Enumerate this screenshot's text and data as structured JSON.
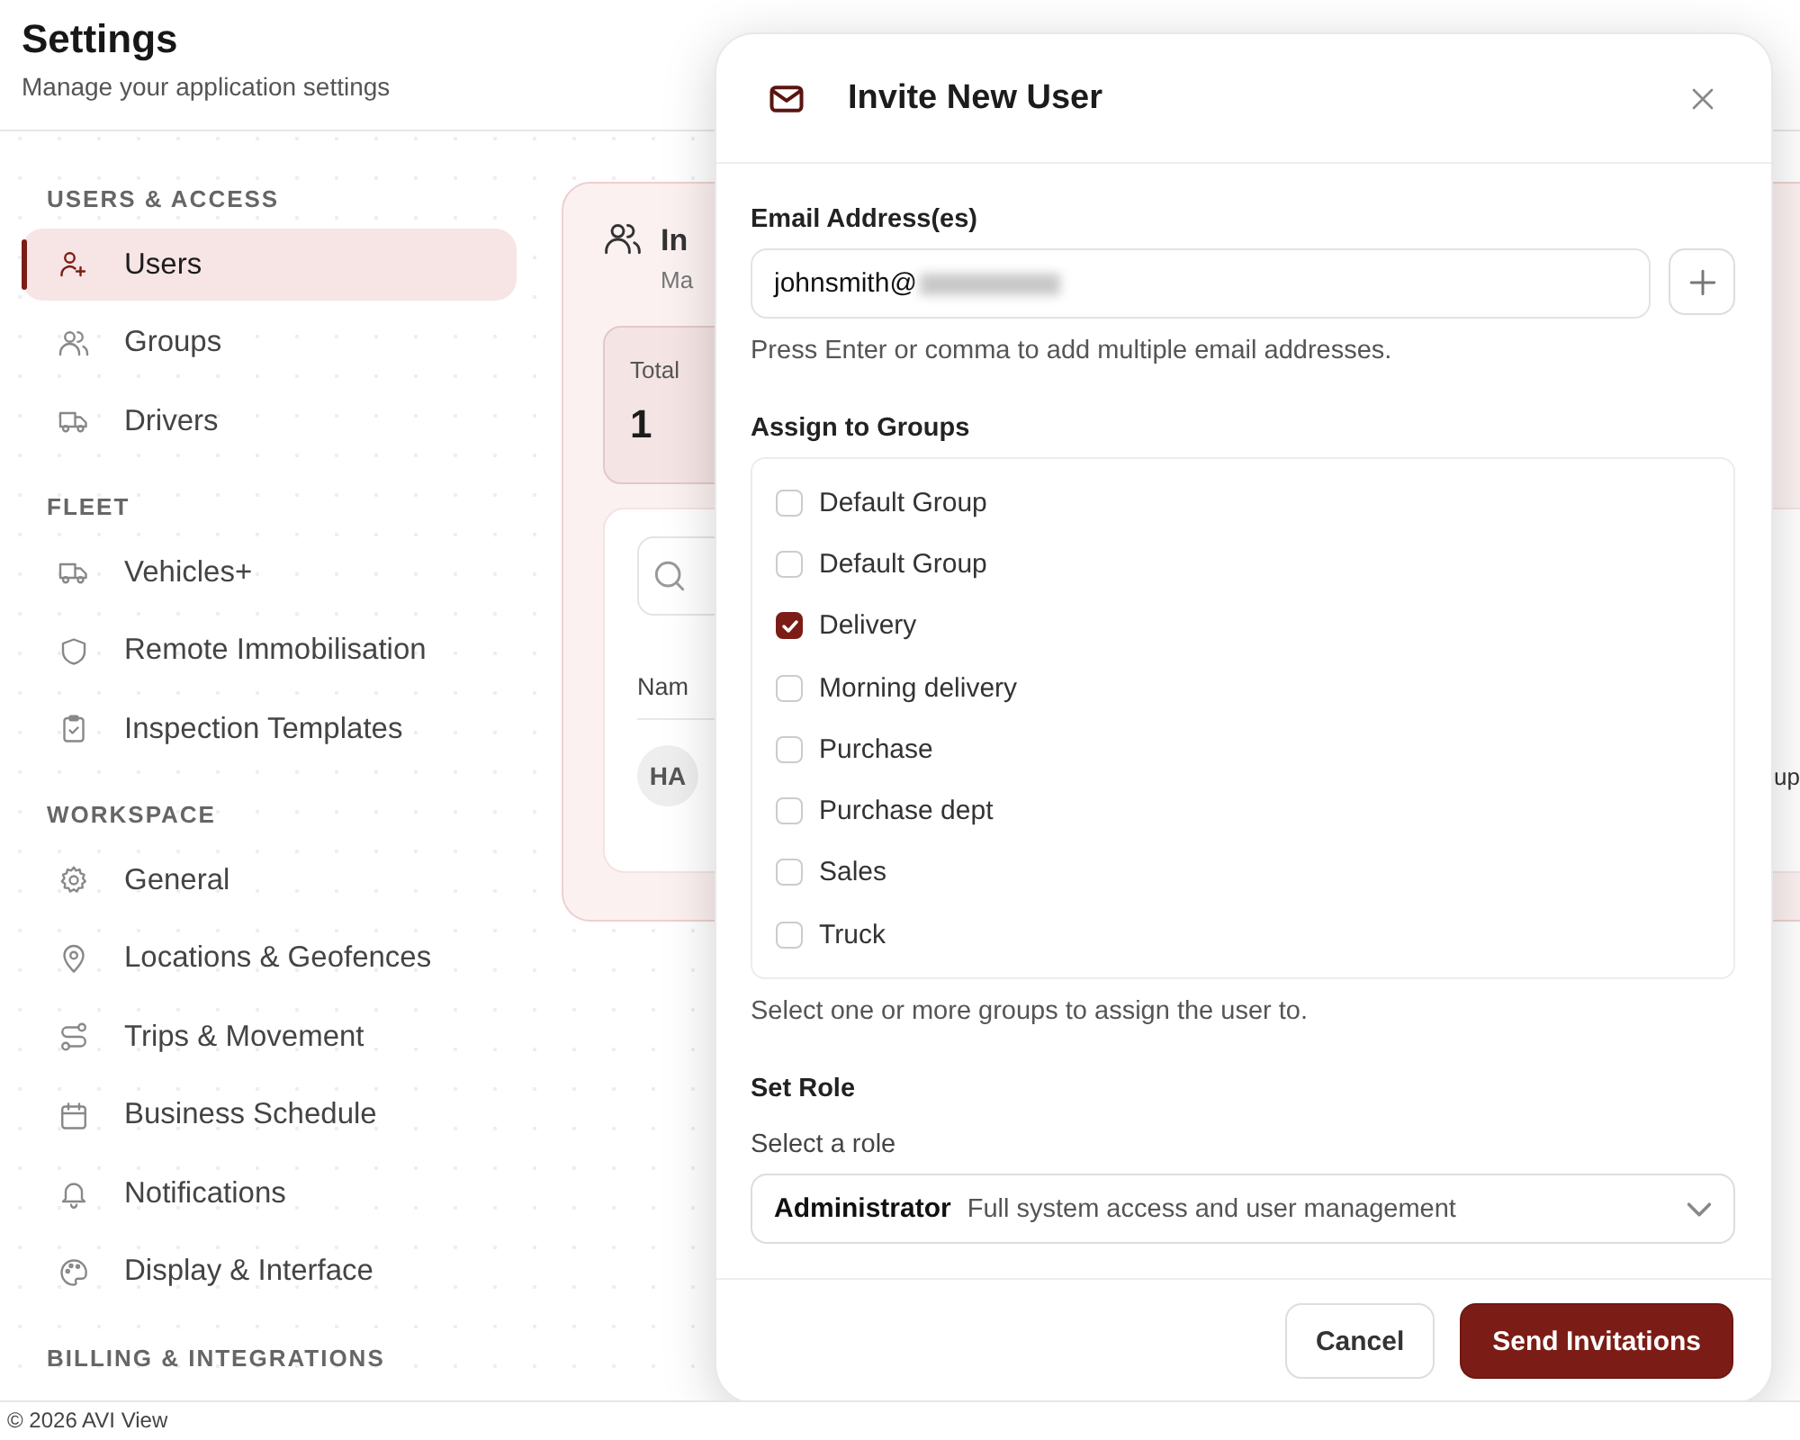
{
  "header": {
    "title": "Settings",
    "subtitle": "Manage your application settings"
  },
  "sidebar": {
    "sections": [
      {
        "heading": "USERS & ACCESS",
        "items": [
          {
            "label": "Users",
            "selected": true
          },
          {
            "label": "Groups",
            "selected": false
          },
          {
            "label": "Drivers",
            "selected": false
          }
        ]
      },
      {
        "heading": "FLEET",
        "items": [
          {
            "label": "Vehicles+",
            "selected": false
          },
          {
            "label": "Remote Immobilisation",
            "selected": false
          },
          {
            "label": "Inspection Templates",
            "selected": false
          }
        ]
      },
      {
        "heading": "WORKSPACE",
        "items": [
          {
            "label": "General",
            "selected": false
          },
          {
            "label": "Locations & Geofences",
            "selected": false
          },
          {
            "label": "Trips & Movement",
            "selected": false
          },
          {
            "label": "Business Schedule",
            "selected": false
          },
          {
            "label": "Notifications",
            "selected": false
          },
          {
            "label": "Display & Interface",
            "selected": false
          }
        ]
      },
      {
        "heading": "BILLING & INTEGRATIONS"
      }
    ]
  },
  "background_card": {
    "title": "In",
    "subtitle": "Ma",
    "stat_label": "Total",
    "stat_value": "1",
    "column_header": "Nam",
    "avatar": "HA",
    "cell": "up"
  },
  "footer": {
    "text": "© 2026 AVI View"
  },
  "dialog": {
    "title": "Invite New User",
    "email_label": "Email Address(es)",
    "email_value": "johnsmith@",
    "email_hint": "Press Enter or comma to add multiple email addresses.",
    "groups_label": "Assign to Groups",
    "groups": [
      {
        "label": "Default Group",
        "checked": false
      },
      {
        "label": "Default Group",
        "checked": false
      },
      {
        "label": "Delivery",
        "checked": true
      },
      {
        "label": "Morning delivery",
        "checked": false
      },
      {
        "label": "Purchase",
        "checked": false
      },
      {
        "label": "Purchase dept",
        "checked": false
      },
      {
        "label": "Sales",
        "checked": false
      },
      {
        "label": "Truck",
        "checked": false
      }
    ],
    "groups_hint": "Select one or more groups to assign the user to.",
    "role_heading": "Set Role",
    "role_label": "Select a role",
    "role": {
      "name": "Administrator",
      "description": "Full system access and user management"
    },
    "buttons": [
      {
        "label": "Cancel",
        "kind": "secondary"
      },
      {
        "label": "Send Invitations",
        "kind": "primary"
      }
    ]
  }
}
